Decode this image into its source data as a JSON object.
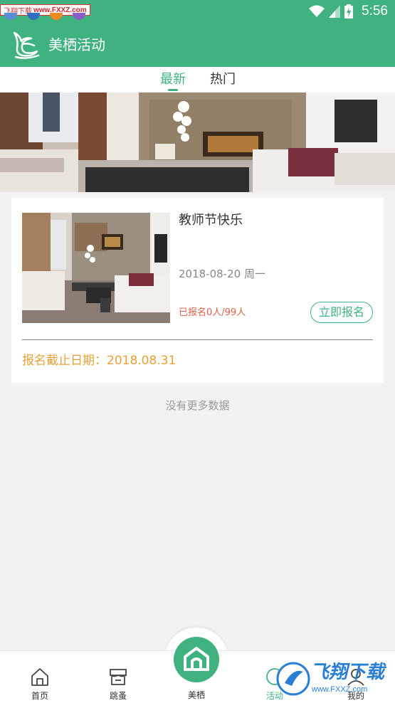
{
  "status_bar": {
    "time": "5:56",
    "watermark_prefix": "飞翔下载",
    "watermark_url": "www.FXXZ.com"
  },
  "app_bar": {
    "title": "美栖活动"
  },
  "tabs": [
    {
      "label": "最新",
      "active": true
    },
    {
      "label": "热门",
      "active": false
    }
  ],
  "activity": {
    "title": "教师节快乐",
    "date": "2018-08-20 周一",
    "signup_status": "已报名0人/99人",
    "signup_button": "立即报名",
    "deadline": "报名截止日期：2018.08.31"
  },
  "no_more_text": "没有更多数据",
  "bottom_nav": {
    "home": "首页",
    "market": "跳蚤",
    "center": "美栖",
    "activity": "活动",
    "me": "我的"
  },
  "watermark": {
    "brand": "飞翔下载",
    "url": "www.FXXZ.com"
  },
  "colors": {
    "primary": "#3fb27f",
    "warning": "#e8a038",
    "alert": "#e0624a"
  }
}
